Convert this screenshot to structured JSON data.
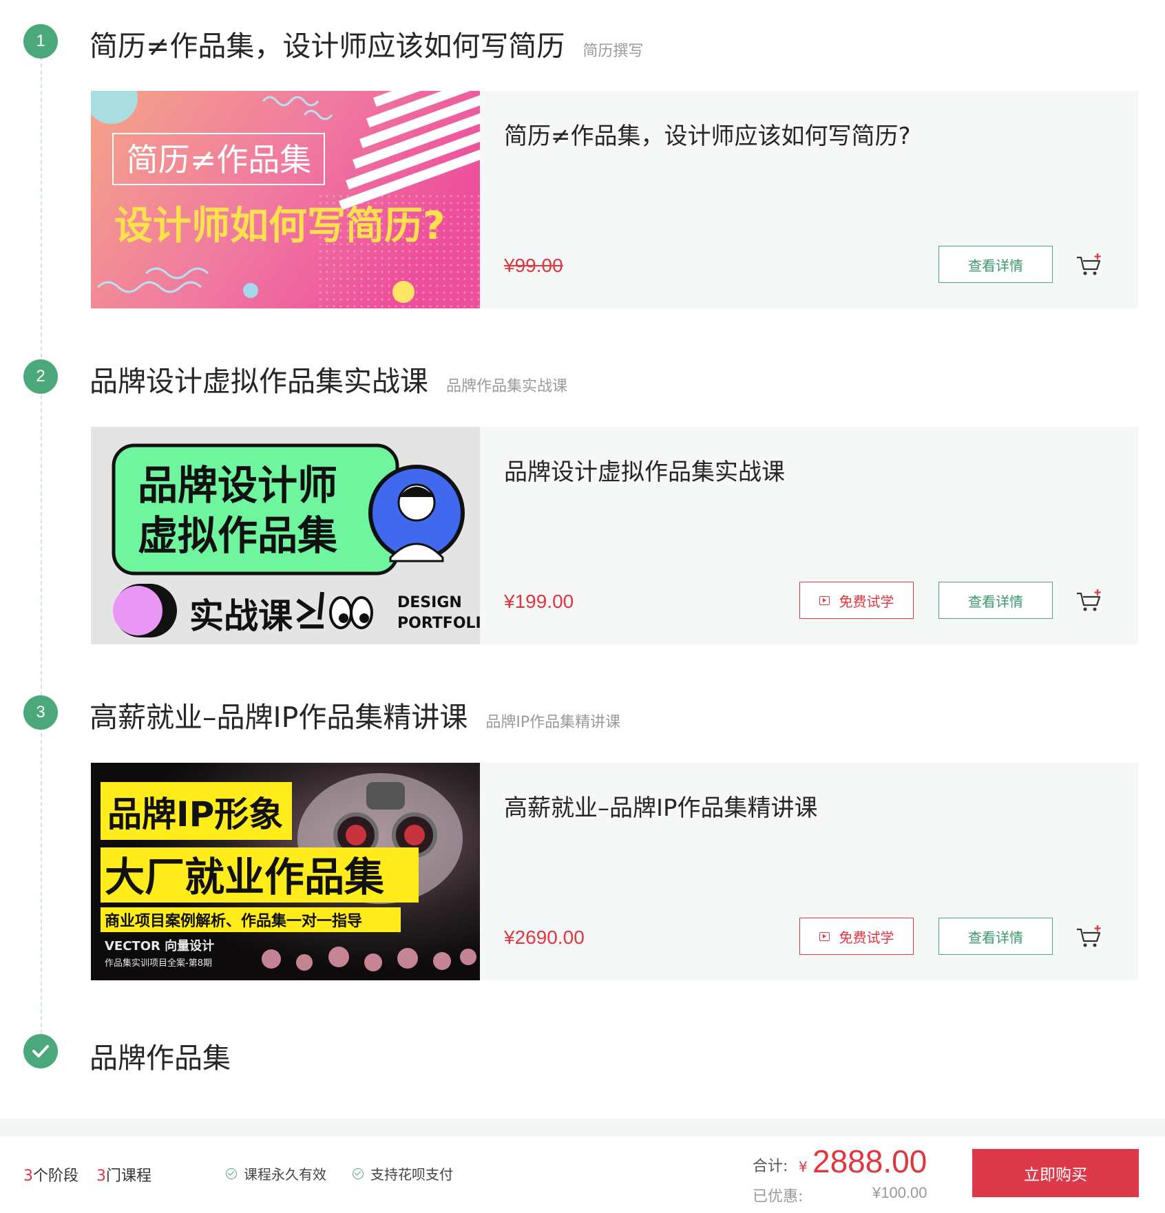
{
  "steps": [
    {
      "number": "1",
      "title": "简历≠作品集，设计师应该如何写简历",
      "subtitle": "简历撰写",
      "course": {
        "title": "简历≠作品集，设计师应该如何写简历?",
        "price": "¥99.00",
        "detail_label": "查看详情",
        "thumb_line1": "简历≠作品集",
        "thumb_line2": "设计师如何写简历?"
      }
    },
    {
      "number": "2",
      "title": "品牌设计虚拟作品集实战课",
      "subtitle": "品牌作品集实战课",
      "course": {
        "title": "品牌设计虚拟作品集实战课",
        "price": "¥199.00",
        "trial_label": "免费试学",
        "detail_label": "查看详情",
        "thumb_line1": "品牌设计师",
        "thumb_line2": "虚拟作品集",
        "thumb_line3": "实战课",
        "thumb_line4": "DESIGN",
        "thumb_line5": "PORTFOLI"
      }
    },
    {
      "number": "3",
      "title": "高薪就业–品牌IP作品集精讲课",
      "subtitle": "品牌IP作品集精讲课",
      "course": {
        "title": "高薪就业–品牌IP作品集精讲课",
        "price": "¥2690.00",
        "trial_label": "免费试学",
        "detail_label": "查看详情",
        "thumb_line1": "品牌IP形象",
        "thumb_line2": "大厂就业作品集",
        "thumb_line3": "商业项目案例解析、作品集一对一指导",
        "thumb_line4": "VECTOR 向量设计",
        "thumb_line5": "作品集实训项目全案-第8期"
      }
    }
  ],
  "final_step": {
    "title": "品牌作品集"
  },
  "footer": {
    "stages_num": "3",
    "stages_label": "个阶段",
    "courses_num": "3",
    "courses_label": "门课程",
    "feature1": "课程永久有效",
    "feature2": "支持花呗支付",
    "total_label": "合计:",
    "currency": "¥",
    "total": "2888.00",
    "discount_label": "已优惠:",
    "discount": "¥100.00",
    "buy_label": "立即购买"
  },
  "colors": {
    "accent_green": "#4aa87b",
    "price_red": "#e0363f",
    "buy_red": "#dc3a4a"
  }
}
